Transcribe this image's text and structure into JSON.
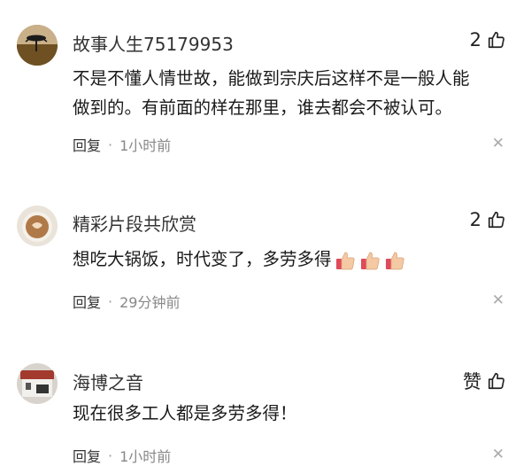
{
  "comments": [
    {
      "username": "故事人生75179953",
      "likes": "2",
      "text_lines": [
        "不是不懂人情世故，能做到宗庆后这样不是一般人能",
        "做到的。有前面的样在那里，谁去都会不被认可。"
      ],
      "reply_label": "回复",
      "separator": "·",
      "time": "1小时前"
    },
    {
      "username": "精彩片段共欣赏",
      "likes": "2",
      "text": "想吃大锅饭，时代变了，多劳多得",
      "emoji_name": "thumbs-up-emoji",
      "emoji_count": 3,
      "reply_label": "回复",
      "separator": "·",
      "time": "29分钟前"
    },
    {
      "username": "海博之音",
      "like_label": "赞",
      "text": "现在很多工人都是多劳多得！",
      "reply_label": "回复",
      "separator": "·",
      "time": "1小时前"
    }
  ],
  "icons": {
    "like": "thumb-up-outline-icon",
    "close": "close-icon"
  },
  "colors": {
    "meta_text": "#888888",
    "name": "#333333",
    "emoji_skin": "#f4c9a4",
    "emoji_cuff": "#e04a5a"
  }
}
